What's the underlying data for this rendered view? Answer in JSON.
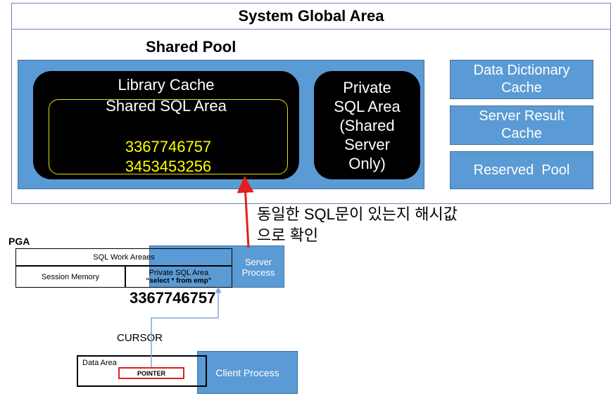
{
  "sga": {
    "title": "System Global Area"
  },
  "shared_pool": {
    "label": "Shared Pool",
    "library_cache": {
      "title": "Library Cache",
      "subtitle": "Shared SQL Area",
      "hash_values": [
        "3367746757",
        "3453453256"
      ]
    },
    "private_sql_area": [
      "Private",
      "SQL Area",
      "(Shared",
      "Server",
      "Only)"
    ]
  },
  "side_boxes": {
    "data_dictionary_cache": [
      "Data Dictionary",
      "Cache"
    ],
    "server_result_cache": [
      "Server Result",
      "Cache"
    ],
    "reserved_pool": "Reserved  Pool"
  },
  "annotation": [
    "동일한 SQL문이 있는지 해시값",
    "으로 확인"
  ],
  "pga": {
    "label": "PGA",
    "sql_work_areas": "SQL Work Areaes",
    "session_memory": "Session Memory",
    "private_sql_area": "Private SQL Area",
    "query": "“select * from emp”",
    "hash_value": "3367746757"
  },
  "server_process": [
    "Server",
    "Process"
  ],
  "cursor_label": "CURSOR",
  "client": {
    "data_area": "Data Area",
    "pointer": "POINTER",
    "process": "Client Process"
  },
  "colors": {
    "box_blue": "#5b9bd5",
    "arrow_red": "#e02020",
    "hash_yellow": "#ffff00",
    "connector_blue": "#7fa8d8"
  }
}
